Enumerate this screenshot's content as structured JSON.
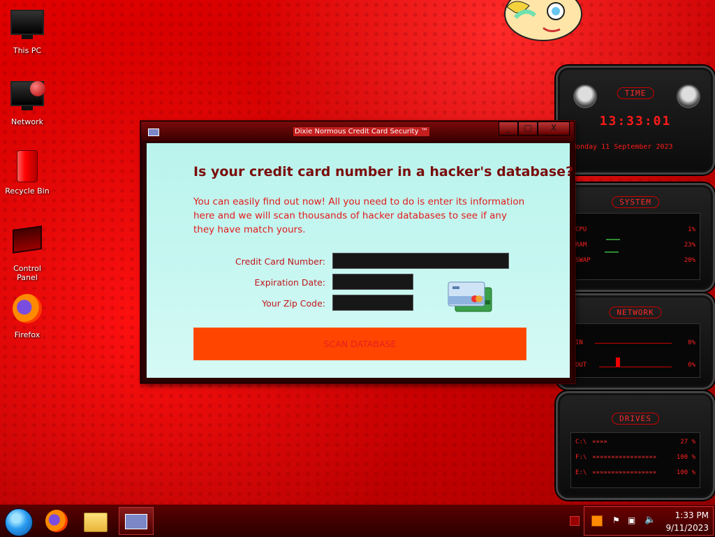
{
  "desktop": {
    "icons": [
      {
        "label": "This PC"
      },
      {
        "label": "Network"
      },
      {
        "label": "Recycle Bin"
      },
      {
        "label": "Control Panel"
      },
      {
        "label": "Firefox"
      }
    ]
  },
  "gadgets": {
    "time": {
      "title": "TIME",
      "clock": "13:33:01",
      "date": "Monday 11 September 2023"
    },
    "system": {
      "title": "SYSTEM",
      "cpu_label": "CPU",
      "cpu_value": "1%",
      "ram_label": "RAM",
      "ram_value": "23%",
      "swap_label": "SWAP",
      "swap_value": "20%"
    },
    "network": {
      "title": "NETWORK",
      "in_label": "IN",
      "in_value": "0%",
      "out_label": "OUT",
      "out_value": "0%"
    },
    "drives": {
      "title": "DRIVES",
      "items": [
        {
          "label": "C:\\",
          "value": "27 %"
        },
        {
          "label": "F:\\",
          "value": "100 %"
        },
        {
          "label": "E:\\",
          "value": "100 %"
        }
      ]
    }
  },
  "window": {
    "title": "Dixie Normous Credit Card Security ™",
    "minimize": "_",
    "maximize": "□",
    "close": "X",
    "headline": "Is your credit card number in a hacker's database?",
    "paragraph": "You can easily find out now! All you need to do is enter its information here and we will scan thousands of hacker databases to see if any they have match yours.",
    "form": {
      "card_label": "Credit Card Number:",
      "card_value": "",
      "exp_label": "Expiration Date:",
      "exp_value": "",
      "zip_label": "Your Zip Code:",
      "zip_value": ""
    },
    "scan_button": "SCAN DATABASE"
  },
  "taskbar": {
    "time": "1:33 PM",
    "date": "9/11/2023"
  }
}
